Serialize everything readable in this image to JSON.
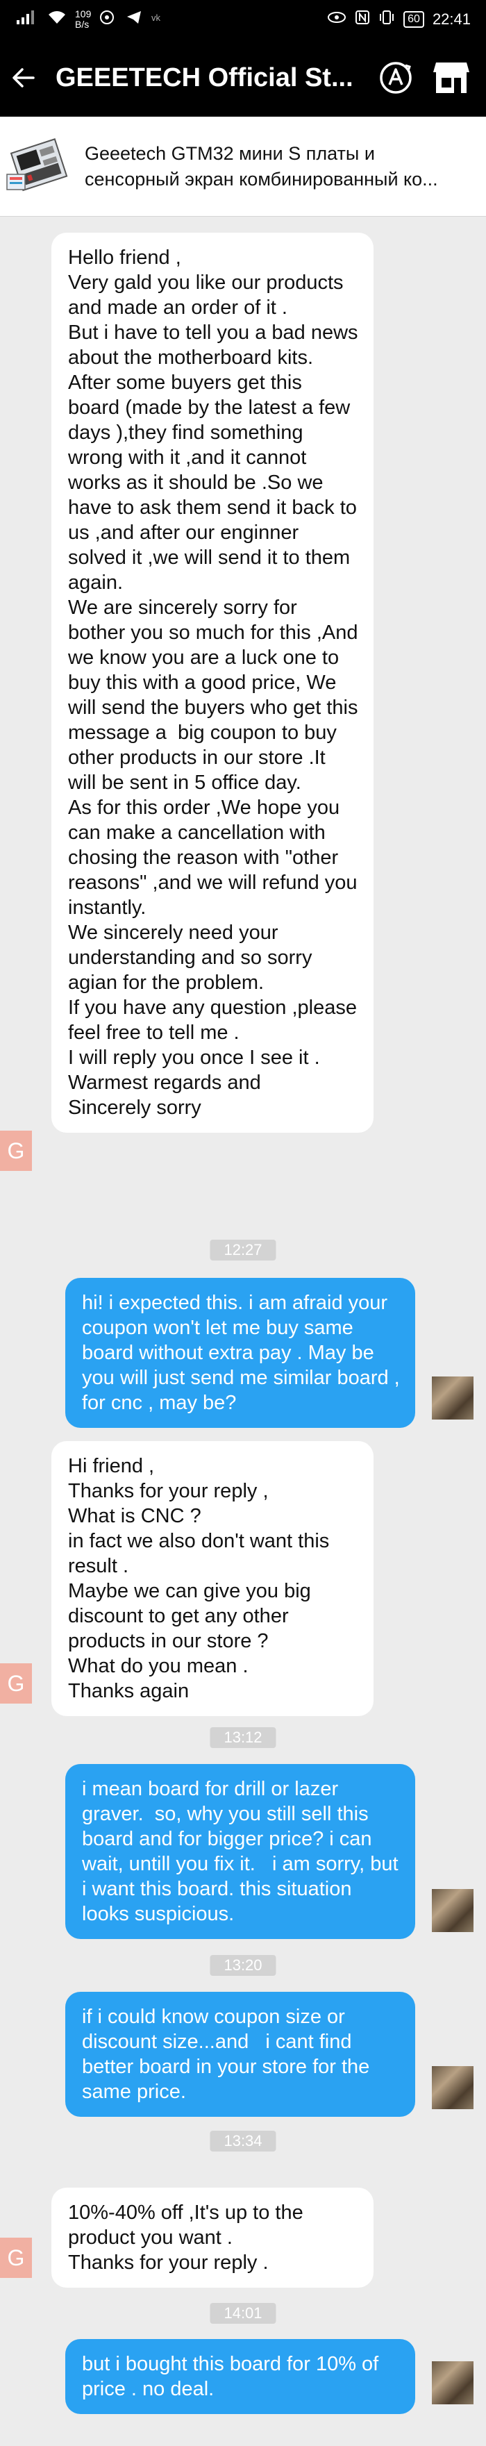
{
  "status_bar": {
    "net_speed_value": "109",
    "net_speed_unit": "B/s",
    "battery": "60",
    "time": "22:41"
  },
  "app_bar": {
    "title": "GEEETECH Official St...",
    "back_icon": "back-arrow-icon",
    "translate_icon": "translate-icon",
    "store_icon": "store-icon"
  },
  "product": {
    "name": "Geeetech GTM32 мини S платы и сенсорный экран комбинированный ко..."
  },
  "messages": [
    {
      "type": "in",
      "text": "Hello friend ,\nVery gald you like our products and made an order of it .\nBut i have to tell you a bad news about the motherboard kits.\nAfter some buyers get this board (made by the latest a few days ),they find something wrong with it ,and it cannot works as it should be .So we have to ask them send it back to us ,and after our enginner solved it ,we will send it to them again.\nWe are sincerely sorry for bother you so much for this ,And we know you are a luck one to buy this with a good price, We will send the buyers who get this message a  big coupon to buy other products in our store .It will be sent in 5 office day.\nAs for this order ,We hope you can make a cancellation with chosing the reason with \"other reasons\" ,and we will refund you instantly.\nWe sincerely need your understanding and so sorry agian for the problem.\nIf you have any question ,please feel free to tell me .\nI will reply you once I see it .\nWarmest regards and\nSincerely sorry"
    },
    {
      "type": "time",
      "text": "12:27"
    },
    {
      "type": "out",
      "text": "hi! i expected this. i am afraid your coupon won't let me buy same board without extra pay . May be you will just send me similar board , for cnc , may be?"
    },
    {
      "type": "in",
      "text": "Hi friend ,\nThanks for your reply ,\nWhat is CNC ?\nin fact we also don't want this result .\nMaybe we can give you big discount to get any other products in our store ?\nWhat do you mean .\nThanks again"
    },
    {
      "type": "time",
      "text": "13:12"
    },
    {
      "type": "out",
      "text": "i mean board for drill or lazer graver.  so, why you still sell this board and for bigger price? i can wait, untill you fix it.   i am sorry, but i want this board. this situation looks suspicious."
    },
    {
      "type": "time",
      "text": "13:20"
    },
    {
      "type": "out",
      "text": "if i could know coupon size or discount size...and   i cant find better board in your store for the same price."
    },
    {
      "type": "time",
      "text": "13:34"
    },
    {
      "type": "in",
      "text": "10%-40% off ,It's up to the product you want .\nThanks for your reply ."
    },
    {
      "type": "time",
      "text": "14:01"
    },
    {
      "type": "out",
      "text": "but i bought this board for 10% of price . no deal."
    }
  ],
  "seller_avatar_letter": "G",
  "colors": {
    "incoming_bubble": "#ffffff",
    "outgoing_bubble": "#2aa2f2",
    "background": "#ececec",
    "seller_avatar": "#f1b0a2"
  }
}
